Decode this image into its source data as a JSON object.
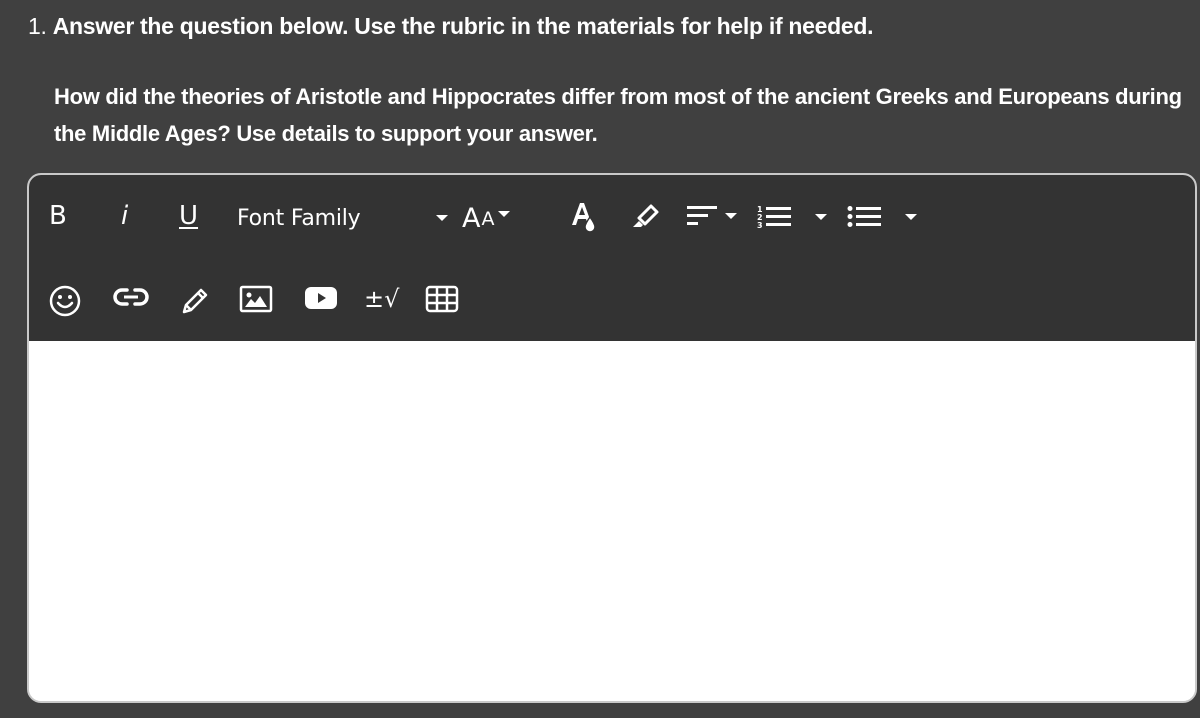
{
  "question": {
    "number": "1.",
    "instruction": "Answer the question below. Use the rubric in the materials for help if needed.",
    "prompt": "How did the theories of Aristotle and Hippocrates differ from most of the ancient Greeks and Europeans during the Middle Ages? Use details to support your answer."
  },
  "toolbar": {
    "bold_label": "B",
    "italic_label": "i",
    "underline_label": "U",
    "font_family_label": "Font Family",
    "font_size_big": "A",
    "font_size_small": "A",
    "math_label": "±√",
    "icons": [
      "bold-icon",
      "italic-icon",
      "underline-icon",
      "font-family-dropdown",
      "font-size-icon",
      "text-color-icon",
      "highlight-icon",
      "align-icon",
      "ordered-list-icon",
      "unordered-list-icon",
      "emoji-icon",
      "link-icon",
      "pencil-icon",
      "image-icon",
      "video-icon",
      "math-icon",
      "table-icon"
    ]
  },
  "editor": {
    "content": ""
  }
}
